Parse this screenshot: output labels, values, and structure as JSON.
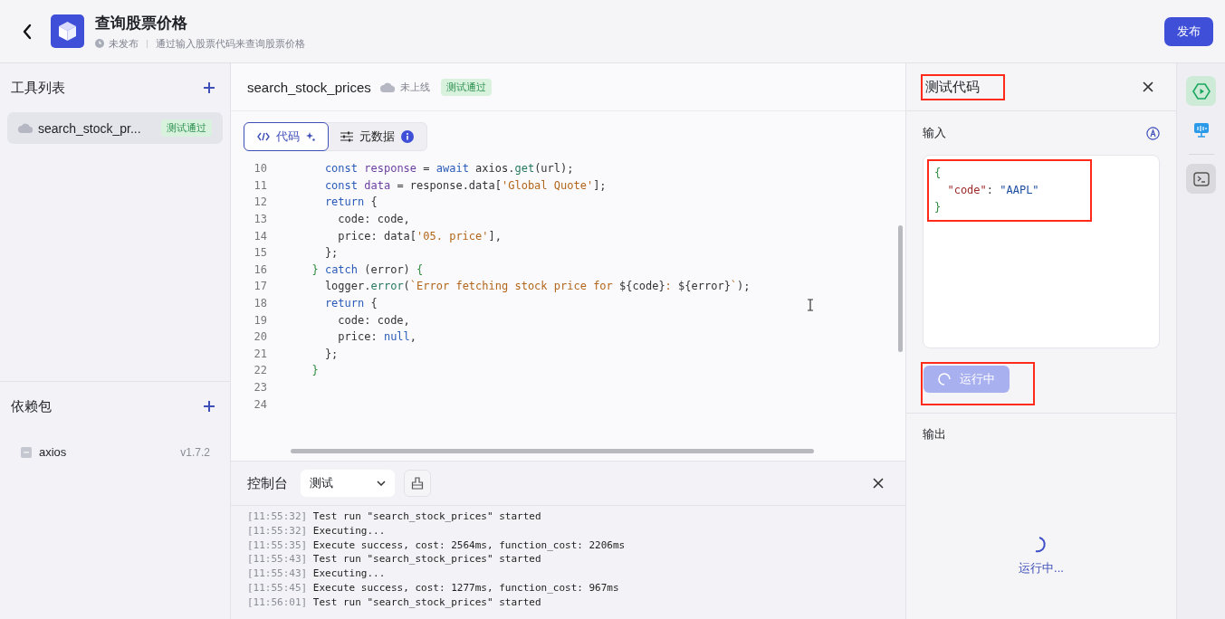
{
  "header": {
    "title": "查询股票价格",
    "status": "未发布",
    "description": "通过输入股票代码来查询股票价格",
    "publish_button": "发布"
  },
  "tools": {
    "title": "工具列表",
    "items": [
      {
        "name": "search_stock_pr...",
        "badge": "测试通过",
        "selected": true
      }
    ]
  },
  "dependencies": {
    "title": "依赖包",
    "items": [
      {
        "name": "axios",
        "version": "v1.7.2"
      }
    ]
  },
  "editor": {
    "title": "search_stock_prices",
    "status": "未上线",
    "badge": "测试通过",
    "tabs": [
      {
        "label": "代码",
        "kind": "code",
        "selected": true
      },
      {
        "label": "元数据",
        "kind": "meta",
        "selected": false
      }
    ],
    "lines": [
      {
        "number": "10",
        "tokens": [
          {
            "kind": "kw",
            "text": "    const"
          },
          {
            "kind": "var",
            "text": " response"
          },
          {
            "kind": "plain",
            "text": " = "
          },
          {
            "kind": "kw",
            "text": "await"
          },
          {
            "kind": "plain",
            "text": " axios."
          },
          {
            "kind": "fn",
            "text": "get"
          },
          {
            "kind": "plain",
            "text": "(url);"
          }
        ]
      },
      {
        "number": "11",
        "tokens": [
          {
            "kind": "kw",
            "text": "    const"
          },
          {
            "kind": "var",
            "text": " data"
          },
          {
            "kind": "plain",
            "text": " = response.data["
          },
          {
            "kind": "str",
            "text": "'Global Quote'"
          },
          {
            "kind": "plain",
            "text": "];"
          }
        ]
      },
      {
        "number": "12",
        "tokens": [
          {
            "kind": "kw",
            "text": "    return"
          },
          {
            "kind": "plain",
            "text": " {"
          }
        ]
      },
      {
        "number": "13",
        "tokens": [
          {
            "kind": "plain",
            "text": "      code: code,"
          }
        ]
      },
      {
        "number": "14",
        "tokens": [
          {
            "kind": "plain",
            "text": "      price: data["
          },
          {
            "kind": "str",
            "text": "'05. price'"
          },
          {
            "kind": "plain",
            "text": "],"
          }
        ]
      },
      {
        "number": "15",
        "tokens": [
          {
            "kind": "plain",
            "text": "    };"
          }
        ]
      },
      {
        "number": "16",
        "tokens": [
          {
            "kind": "brace",
            "text": "  }"
          },
          {
            "kind": "kw",
            "text": " catch"
          },
          {
            "kind": "plain",
            "text": " (error) "
          },
          {
            "kind": "brace",
            "text": "{"
          }
        ]
      },
      {
        "number": "17",
        "tokens": [
          {
            "kind": "plain",
            "text": "    logger."
          },
          {
            "kind": "fn",
            "text": "error"
          },
          {
            "kind": "plain",
            "text": "("
          },
          {
            "kind": "str",
            "text": "`Error fetching stock price for "
          },
          {
            "kind": "plain",
            "text": "${code}"
          },
          {
            "kind": "str",
            "text": ": "
          },
          {
            "kind": "plain",
            "text": "${error}"
          },
          {
            "kind": "str",
            "text": "`"
          },
          {
            "kind": "plain",
            "text": ");"
          }
        ]
      },
      {
        "number": "18",
        "tokens": [
          {
            "kind": "kw",
            "text": "    return"
          },
          {
            "kind": "plain",
            "text": " {"
          }
        ]
      },
      {
        "number": "19",
        "tokens": [
          {
            "kind": "plain",
            "text": "      code: code,"
          }
        ]
      },
      {
        "number": "20",
        "tokens": [
          {
            "kind": "plain",
            "text": "      price: "
          },
          {
            "kind": "kw",
            "text": "null"
          },
          {
            "kind": "plain",
            "text": ","
          }
        ]
      },
      {
        "number": "21",
        "tokens": [
          {
            "kind": "plain",
            "text": "    };"
          }
        ]
      },
      {
        "number": "22",
        "tokens": [
          {
            "kind": "brace",
            "text": "  }"
          }
        ]
      },
      {
        "number": "23"
      },
      {
        "number": "24"
      }
    ]
  },
  "console": {
    "title": "控制台",
    "filter": "测试",
    "logs": [
      {
        "time": "[11:55:32]",
        "message": "Test run \"search_stock_prices\" started"
      },
      {
        "time": "[11:55:32]",
        "message": "Executing..."
      },
      {
        "time": "[11:55:35]",
        "message": "Execute success, cost: 2564ms, function_cost: 2206ms"
      },
      {
        "time": "[11:55:43]",
        "message": "Test run \"search_stock_prices\" started"
      },
      {
        "time": "[11:55:43]",
        "message": "Executing..."
      },
      {
        "time": "[11:55:45]",
        "message": "Execute success, cost: 1277ms, function_cost: 967ms"
      },
      {
        "time": "[11:56:01]",
        "message": "Test run \"search_stock_prices\" started"
      }
    ]
  },
  "test_panel": {
    "title": "测试代码",
    "title_highlighted": true,
    "input_label": "输入",
    "input_highlighted": true,
    "input_lines": [
      {
        "tokens": [
          {
            "kind": "brace",
            "text": "{"
          }
        ]
      },
      {
        "tokens": [
          {
            "kind": "key",
            "text": "  \"code\""
          },
          {
            "kind": "plain",
            "text": ": "
          },
          {
            "kind": "val",
            "text": "\"AAPL\""
          }
        ]
      },
      {
        "tokens": [
          {
            "kind": "brace",
            "text": "}"
          }
        ]
      }
    ],
    "run_button": {
      "label": "运行中",
      "busy": true,
      "highlighted": true
    },
    "output_label": "输出",
    "output_status": "运行中..."
  },
  "rail": [
    {
      "kind": "run",
      "selected": true
    },
    {
      "kind": "monitor",
      "selected": false
    },
    {
      "kind": "terminal",
      "selected": false
    }
  ]
}
